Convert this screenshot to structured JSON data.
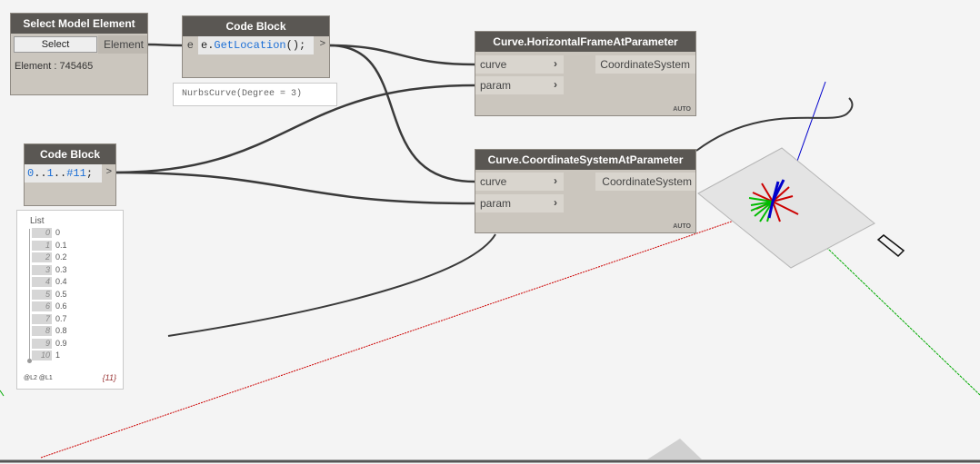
{
  "select_node": {
    "title": "Select Model Element",
    "button_label": "Select",
    "output_port": "Element",
    "status": "Element : 745465"
  },
  "code_block_1": {
    "title": "Code Block",
    "input_port": "e",
    "code": "e.GetLocation();",
    "output_port": ">",
    "preview": "NurbsCurve(Degree = 3)"
  },
  "code_block_2": {
    "title": "Code Block",
    "code_parts": [
      "0",
      "..",
      "1",
      "..",
      "#11",
      ";"
    ],
    "output_port": ">"
  },
  "horizontal_node": {
    "title": "Curve.HorizontalFrameAtParameter",
    "inputs": [
      "curve",
      "param"
    ],
    "output": "CoordinateSystem",
    "lacing": "AUTO"
  },
  "coordsys_node": {
    "title": "Curve.CoordinateSystemAtParameter",
    "inputs": [
      "curve",
      "param"
    ],
    "output": "CoordinateSystem",
    "lacing": "AUTO"
  },
  "list_preview": {
    "header": "List",
    "items": [
      {
        "index": "0",
        "value": "0"
      },
      {
        "index": "1",
        "value": "0.1"
      },
      {
        "index": "2",
        "value": "0.2"
      },
      {
        "index": "3",
        "value": "0.3"
      },
      {
        "index": "4",
        "value": "0.4"
      },
      {
        "index": "5",
        "value": "0.5"
      },
      {
        "index": "6",
        "value": "0.6"
      },
      {
        "index": "7",
        "value": "0.7"
      },
      {
        "index": "8",
        "value": "0.8"
      },
      {
        "index": "9",
        "value": "0.9"
      },
      {
        "index": "10",
        "value": "1"
      }
    ],
    "levels": "@L2 @L1",
    "count": "{11}"
  },
  "colors": {
    "node_header": "#5a5753",
    "node_body": "#cbc6be",
    "wire": "#3a3a3a",
    "axis_x": "#cc0000",
    "axis_y": "#00aa00",
    "axis_z": "#0000cc",
    "code_blue": "#1c6fd6"
  }
}
